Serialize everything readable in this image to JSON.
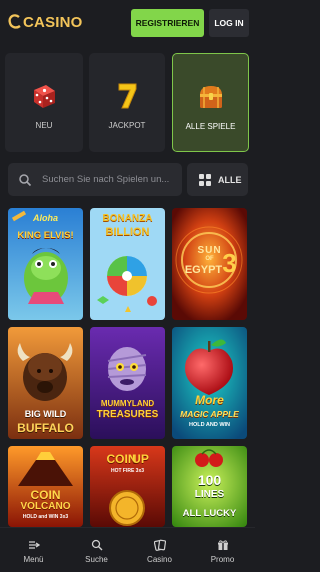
{
  "header": {
    "logo_text": "CASINO",
    "register_label": "REGISTRIEREN",
    "login_label": "LOG IN"
  },
  "categories": [
    {
      "label": "NEU",
      "icon": "dice-icon"
    },
    {
      "label": "JACKPOT",
      "icon": "seven-icon"
    },
    {
      "label": "ALLE SPIELE",
      "icon": "treasure-chest-icon",
      "active": true
    }
  ],
  "search": {
    "placeholder": "Suchen Sie nach Spielen un..."
  },
  "filter": {
    "label": "ALLE"
  },
  "games": [
    {
      "title": "Aloha King Elvis!"
    },
    {
      "title": "Bonanza Billion"
    },
    {
      "title": "Sun of Egypt 3"
    },
    {
      "title": "Big Wild Buffalo"
    },
    {
      "title": "Mummyland Treasures"
    },
    {
      "title": "More Magic Apple"
    },
    {
      "title": "Coin Volcano"
    },
    {
      "title": "Coin Up"
    },
    {
      "title": "100 Lines All Lucky"
    }
  ],
  "game_art_text": {
    "g1": [
      "Aloha",
      "KING ELVIS!"
    ],
    "g2": [
      "BONANZA",
      "BILLION"
    ],
    "g3": [
      "SUN",
      "OF",
      "EGYPT",
      "3"
    ],
    "g4": [
      "BIG WILD",
      "BUFFALO"
    ],
    "g5": [
      "MUMMYLAND",
      "TREASURES"
    ],
    "g6": [
      "More",
      "MAGIC APPLE",
      "HOLD AND WIN"
    ],
    "g7": [
      "COIN",
      "VOLCANO",
      "HOLD and WIN 3x3"
    ],
    "g8": [
      "COIN",
      "UP",
      "HOT FIRE 3x3"
    ],
    "g9": [
      "100",
      "LINES",
      "ALL LUCKY"
    ]
  },
  "bottom_nav": [
    {
      "label": "Menü",
      "icon": "menu-arrow-icon"
    },
    {
      "label": "Suche",
      "icon": "search-icon"
    },
    {
      "label": "Casino",
      "icon": "cards-icon"
    },
    {
      "label": "Promo",
      "icon": "gift-icon"
    }
  ],
  "colors": {
    "accent": "#82d64a",
    "background": "#1c1d21",
    "logo": "#f2c45a"
  }
}
